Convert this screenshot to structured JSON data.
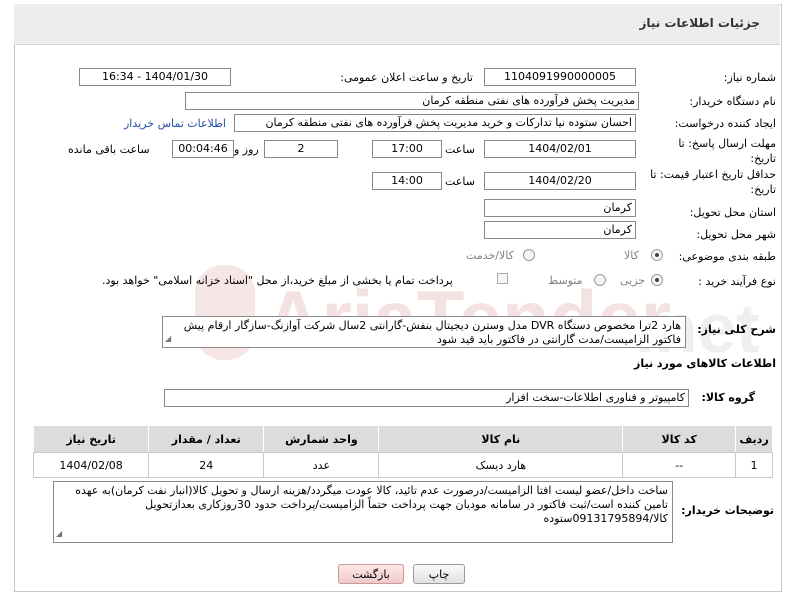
{
  "header": {
    "title": "جزئیات اطلاعات نیاز"
  },
  "form": {
    "need_number": {
      "label": "شماره نیاز:",
      "value": "1104091990000005"
    },
    "announce_datetime": {
      "label": "تاریخ و ساعت اعلان عمومی:",
      "value": "1404/01/30 - 16:34"
    },
    "buyer_org": {
      "label": "نام دستگاه خریدار:",
      "value": "مدیریت پخش فرآورده های نفتی منطقه کرمان"
    },
    "requester": {
      "label": "ایجاد کننده درخواست:",
      "value": "احسان  ستوده نیا  تدارکات و خرید  مدیریت پخش فرآورده های نفتی منطقه کرمان",
      "contact_link": "اطلاعات تماس خریدار"
    },
    "reply_deadline": {
      "label": "مهلت ارسال پاسخ: تا تاریخ:",
      "date": "1404/02/01",
      "time_label": "ساعت",
      "time": "17:00",
      "days": "2",
      "days_label": "روز و",
      "remaining": "00:04:46",
      "remaining_label": "ساعت باقی مانده"
    },
    "price_validity": {
      "label": "حداقل تاریخ اعتبار قیمت: تا تاریخ:",
      "date": "1404/02/20",
      "time_label": "ساعت",
      "time": "14:00"
    },
    "delivery_province": {
      "label": "استان محل تحویل:",
      "value": "کرمان"
    },
    "delivery_city": {
      "label": "شهر محل تحویل:",
      "value": "کرمان"
    },
    "category": {
      "label": "طبقه بندی موضوعی:",
      "options": [
        "کالا",
        "کالا/خدمت"
      ],
      "selected": "کالا"
    },
    "purchase_type": {
      "label": "نوع فرآیند خرید :",
      "options": [
        "جزیی",
        "متوسط"
      ],
      "selected": "جزیی",
      "payment_note": "پرداخت تمام یا بخشی از مبلغ خرید،از محل \"اسناد خزانه اسلامی\" خواهد بود."
    },
    "description": {
      "label": "شرح کلی نیاز:",
      "text": "هارد 2ترا مخصوص دستگاه DVR مدل وسترن دیجیتال بنفش-گارانتی 2سال شرکت آوازنگ-سازگار ارقام پیش فاکتور الزامیست/مدت گارانتی در فاکتور باید قید شود"
    }
  },
  "goods": {
    "section_title": "اطلاعات کالاهای مورد نیاز",
    "group_label": "گروه کالا:",
    "group_value": "کامپیوتر و فناوری اطلاعات-سخت افزار",
    "columns": [
      "ردیف",
      "کد کالا",
      "نام کالا",
      "واحد شمارش",
      "تعداد / مقدار",
      "تاریخ نیاز"
    ],
    "rows": [
      {
        "row": "1",
        "code": "--",
        "name": "هارد دیسک",
        "unit": "عدد",
        "qty": "24",
        "date": "1404/02/08"
      }
    ]
  },
  "buyer_notes": {
    "label": "توضیحات خریدار:",
    "text": "ساخت داخل/عضو لیست افتا الزامیست/درصورت عدم تائید، کالا عودت میگردد/هزینه ارسال و تحویل کالا(انبار نفت کرمان)به عهده تامین کننده است/ثبت فاکتور در سامانه مودیان جهت پرداخت حتماً الزامیست/پرداخت حدود 30روزکاری بعدازتحویل کالا/09131795894ستوده"
  },
  "buttons": {
    "print": "چاپ",
    "back": "بازگشت"
  },
  "colors": {
    "header_bg": "#ededed",
    "link": "#1f4fa5",
    "table_header": "#dcdcdc",
    "back_button": "#f2c9c9"
  }
}
